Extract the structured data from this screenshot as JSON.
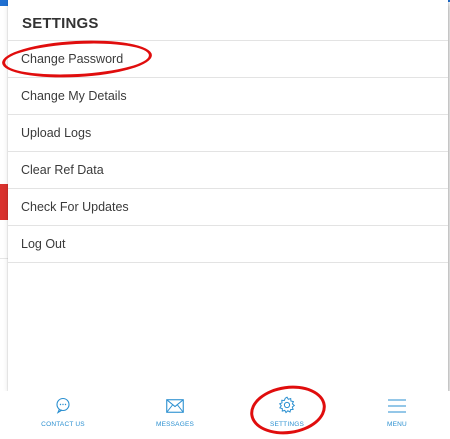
{
  "settings": {
    "title": "SETTINGS",
    "items": [
      {
        "label": "Change Password"
      },
      {
        "label": "Change My Details"
      },
      {
        "label": "Upload Logs"
      },
      {
        "label": "Clear Ref Data"
      },
      {
        "label": "Check For Updates"
      },
      {
        "label": "Log Out"
      }
    ]
  },
  "bottom_nav": {
    "items": [
      {
        "label": "CONTACT US",
        "icon": "chat-bubble-icon"
      },
      {
        "label": "MESSAGES",
        "icon": "envelope-icon"
      },
      {
        "label": "SETTINGS",
        "icon": "gear-icon"
      },
      {
        "label": "MENU",
        "icon": "hamburger-icon"
      }
    ]
  },
  "colors": {
    "accent": "#2a8fd0",
    "annotation": "#e00d0d",
    "text": "#3a3a3a"
  }
}
